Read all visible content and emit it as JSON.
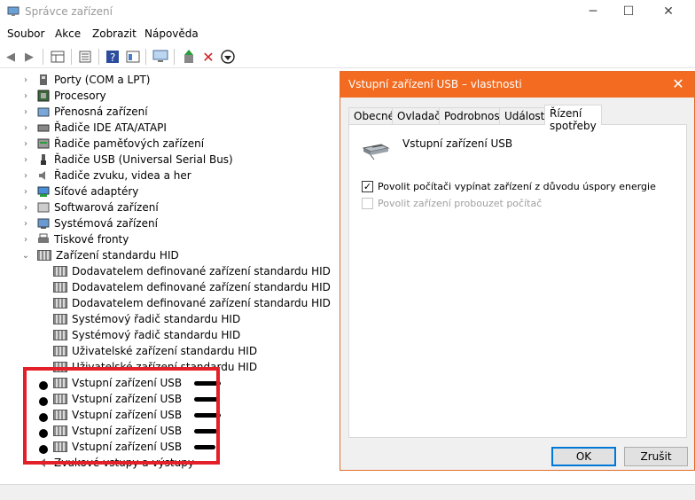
{
  "window": {
    "title": "Správce zařízení",
    "minimize": "─",
    "maximize": "☐",
    "close": "✕"
  },
  "menu": [
    "Soubor",
    "Akce",
    "Zobrazit",
    "Nápověda"
  ],
  "tree": {
    "categories": [
      "Porty (COM a LPT)",
      "Procesory",
      "Přenosná zařízení",
      "Řadiče IDE ATA/ATAPI",
      "Řadiče paměťových zařízení",
      "Řadiče USB (Universal Serial Bus)",
      "Řadiče zvuku, videa a her",
      "Síťové adaptéry",
      "Softwarová zařízení",
      "Systémová zařízení",
      "Tiskové fronty",
      "Zařízení standardu HID"
    ],
    "hid_children": [
      "Dodavatelem definované zařízení standardu HID",
      "Dodavatelem definované zařízení standardu HID",
      "Dodavatelem definované zařízení standardu HID",
      "Systémový řadič standardu HID",
      "Systémový řadič standardu HID",
      "Uživatelské zařízení standardu HID",
      "Uživatelské zařízení standardu HID",
      "Vstupní zařízení USB",
      "Vstupní zařízení USB",
      "Vstupní zařízení USB",
      "Vstupní zařízení USB",
      "Vstupní zařízení USB"
    ],
    "last_category": "Zvukové vstupy a výstupy"
  },
  "dialog": {
    "title": "Vstupní zařízení USB – vlastnosti",
    "close": "✕",
    "tabs": [
      "Obecné",
      "Ovladač",
      "Podrobnosti",
      "Události",
      "Řízení spotřeby"
    ],
    "device_name": "Vstupní zařízení USB",
    "option_wake_off": "Povolit počítači vypínat zařízení z důvodu úspory energie",
    "option_wake_on": "Povolit zařízení probouzet počítač",
    "ok": "OK",
    "cancel": "Zrušit"
  }
}
